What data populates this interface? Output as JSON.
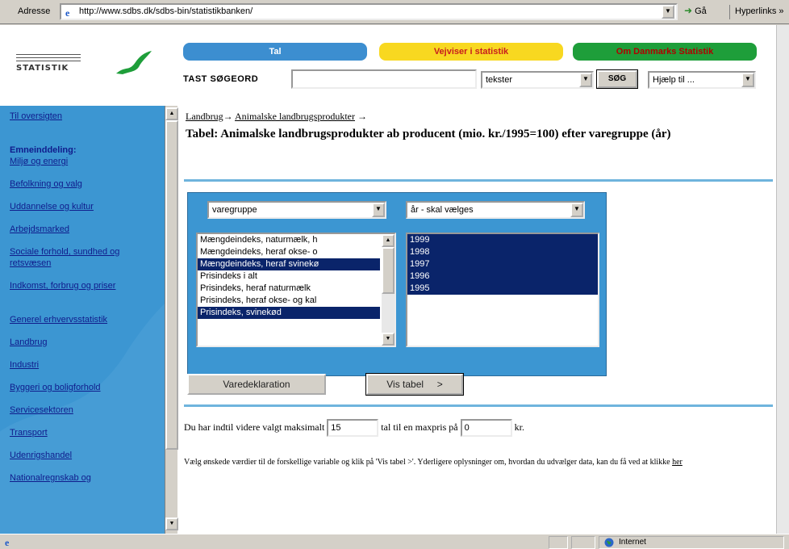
{
  "browser": {
    "address_label": "Adresse",
    "url": "http://www.sdbs.dk/sdbs-bin/statistikbanken/",
    "go_label": "Gå",
    "links_label": "Hyperlinks »",
    "status_zone": "Internet"
  },
  "site": {
    "logo_text": "STATISTIK",
    "nav": {
      "tal": "Tal",
      "vejviser": "Vejviser i statistik",
      "om": "Om Danmarks Statistik"
    },
    "search": {
      "label": "TAST SØGEORD",
      "type_selected": "tekster",
      "button": "SØG",
      "help_selected": "Hjælp til ..."
    }
  },
  "sidebar": {
    "overview": "Til oversigten",
    "heading": "Emneinddeling:",
    "items": [
      "Miljø og energi",
      "Befolkning og valg",
      "Uddannelse og kultur",
      "Arbejdsmarked",
      "Sociale forhold, sundhed og retsvæsen",
      "Indkomst, forbrug og priser",
      "Generel erhvervsstatistik",
      "Landbrug",
      "Industri",
      "Byggeri og boligforhold",
      "Servicesektoren",
      "Transport",
      "Udenrigshandel",
      "Nationalregnskab og"
    ]
  },
  "main": {
    "breadcrumb": {
      "level1": "Landbrug",
      "level2": "Animalske landbrugsprodukter",
      "arrow": "→"
    },
    "title": "Tabel: Animalske landbrugsprodukter ab producent (mio. kr./1995=100) efter varegruppe (år)",
    "variable1": {
      "label": "varegruppe",
      "options": [
        {
          "text": "Mængdeindeks, naturmælk, h",
          "selected": false
        },
        {
          "text": "Mængdeindeks, heraf okse- o",
          "selected": false
        },
        {
          "text": "Mængdeindeks, heraf svinekø",
          "selected": true
        },
        {
          "text": "Prisindeks i alt",
          "selected": false
        },
        {
          "text": "Prisindeks, heraf naturmælk",
          "selected": false
        },
        {
          "text": "Prisindeks, heraf okse- og kal",
          "selected": false
        },
        {
          "text": "Prisindeks, svinekød",
          "selected": true
        }
      ]
    },
    "variable2": {
      "label": "år - skal vælges",
      "options": [
        {
          "text": "1999",
          "selected": true
        },
        {
          "text": "1998",
          "selected": true
        },
        {
          "text": "1997",
          "selected": true
        },
        {
          "text": "1996",
          "selected": true
        },
        {
          "text": "1995",
          "selected": true
        }
      ]
    },
    "buttons": {
      "varedeklaration": "Varedeklaration",
      "vis_tabel": "Vis tabel     >"
    },
    "max_line": {
      "before": "Du har indtil videre valgt maksimalt",
      "max_value": "15",
      "middle": "tal til en maxpris på",
      "price_value": "0",
      "after": "kr."
    },
    "help": {
      "text": "Vælg ønskede værdier til de forskellige variable og klik på 'Vis tabel >'. Yderligere oplysninger om, hvordan du udvælger data, kan du få ved at klikke",
      "link": "her"
    }
  }
}
